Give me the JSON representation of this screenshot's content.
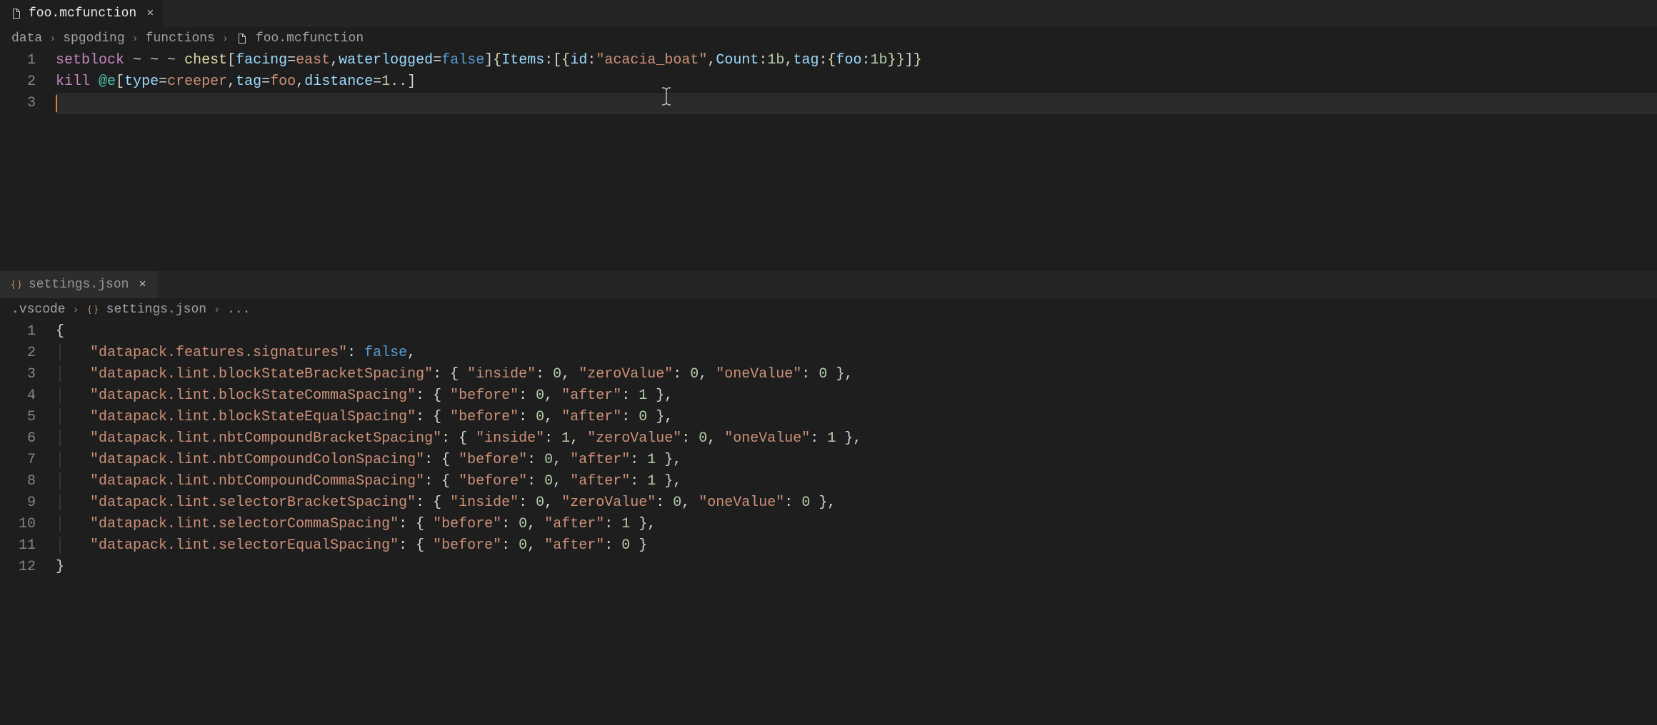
{
  "pane1": {
    "tab": {
      "label": "foo.mcfunction"
    },
    "breadcrumb": [
      "data",
      "spgoding",
      "functions",
      "foo.mcfunction"
    ],
    "lines": {
      "l1": {
        "setblock": "setblock",
        "tildes": "~ ~ ~",
        "chest": "chest",
        "lb1": "[",
        "facing": "facing",
        "eq1": "=",
        "east": "east",
        "c1": ",",
        "waterlogged": "waterlogged",
        "eq2": "=",
        "false": "false",
        "rb1": "]",
        "lbrace1": "{",
        "items": "Items",
        "col1": ":",
        "lsq": "[",
        "lbrace2": "{",
        "id": "id",
        "col2": ":",
        "str": "\"acacia_boat\"",
        "c2": ",",
        "count": "Count",
        "col3": ":",
        "n1": "1b",
        "c3": ",",
        "tag": "tag",
        "col4": ":",
        "lbrace3": "{",
        "foo": "foo",
        "col5": ":",
        "n2": "1b",
        "rbrace3": "}",
        "rbrace2": "}",
        "rsq": "]",
        "rbrace1": "}"
      },
      "l2": {
        "kill": "kill",
        "sp": " ",
        "sel": "@e",
        "lb": "[",
        "type": "type",
        "eq1": "=",
        "creeper": "creeper",
        "c1": ",",
        "tag": "tag",
        "eq2": "=",
        "foo": "foo",
        "c2": ",",
        "distance": "distance",
        "eq3": "=",
        "range": "1..",
        "rb": "]"
      }
    },
    "line_numbers": [
      "1",
      "2",
      "3"
    ]
  },
  "pane2": {
    "tab": {
      "label": "settings.json"
    },
    "breadcrumb": [
      ".vscode",
      "settings.json",
      "..."
    ],
    "line_numbers": [
      "1",
      "2",
      "3",
      "4",
      "5",
      "6",
      "7",
      "8",
      "9",
      "10",
      "11",
      "12"
    ],
    "json": {
      "open": "{",
      "close": "}",
      "rows": [
        {
          "k": "\"datapack.features.signatures\"",
          "v": "false",
          "t": "bool",
          "trail": ","
        },
        {
          "k": "\"datapack.lint.blockStateBracketSpacing\"",
          "o": [
            [
              "\"inside\"",
              "0"
            ],
            [
              "\"zeroValue\"",
              "0"
            ],
            [
              "\"oneValue\"",
              "0"
            ]
          ],
          "trail": ","
        },
        {
          "k": "\"datapack.lint.blockStateCommaSpacing\"",
          "o": [
            [
              "\"before\"",
              "0"
            ],
            [
              "\"after\"",
              "1"
            ]
          ],
          "trail": ","
        },
        {
          "k": "\"datapack.lint.blockStateEqualSpacing\"",
          "o": [
            [
              "\"before\"",
              "0"
            ],
            [
              "\"after\"",
              "0"
            ]
          ],
          "trail": ","
        },
        {
          "k": "\"datapack.lint.nbtCompoundBracketSpacing\"",
          "o": [
            [
              "\"inside\"",
              "1"
            ],
            [
              "\"zeroValue\"",
              "0"
            ],
            [
              "\"oneValue\"",
              "1"
            ]
          ],
          "trail": ","
        },
        {
          "k": "\"datapack.lint.nbtCompoundColonSpacing\"",
          "o": [
            [
              "\"before\"",
              "0"
            ],
            [
              "\"after\"",
              "1"
            ]
          ],
          "trail": ","
        },
        {
          "k": "\"datapack.lint.nbtCompoundCommaSpacing\"",
          "o": [
            [
              "\"before\"",
              "0"
            ],
            [
              "\"after\"",
              "1"
            ]
          ],
          "trail": ","
        },
        {
          "k": "\"datapack.lint.selectorBracketSpacing\"",
          "o": [
            [
              "\"inside\"",
              "0"
            ],
            [
              "\"zeroValue\"",
              "0"
            ],
            [
              "\"oneValue\"",
              "0"
            ]
          ],
          "trail": ","
        },
        {
          "k": "\"datapack.lint.selectorCommaSpacing\"",
          "o": [
            [
              "\"before\"",
              "0"
            ],
            [
              "\"after\"",
              "1"
            ]
          ],
          "trail": ","
        },
        {
          "k": "\"datapack.lint.selectorEqualSpacing\"",
          "o": [
            [
              "\"before\"",
              "0"
            ],
            [
              "\"after\"",
              "0"
            ]
          ],
          "trail": ""
        }
      ]
    }
  }
}
